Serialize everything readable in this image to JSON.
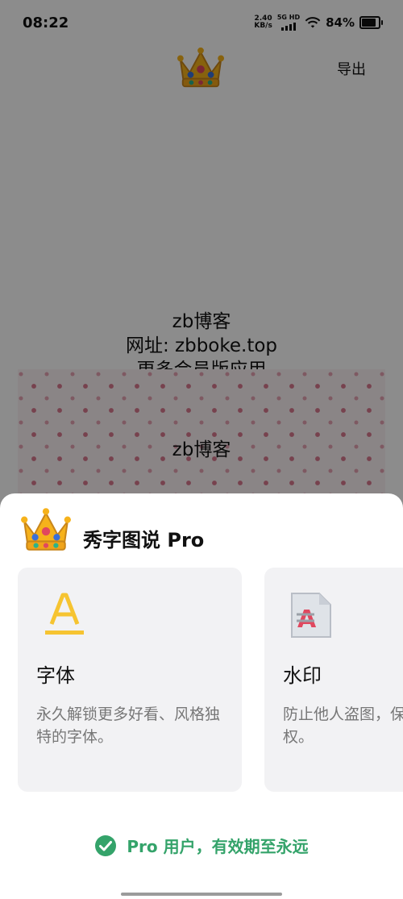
{
  "status_bar": {
    "time": "08:22",
    "net_speed_value": "2.40",
    "net_speed_unit": "KB/s",
    "net_type": "5G HD",
    "battery_percent": "84%",
    "battery_level": 0.84
  },
  "header": {
    "export_label": "导出",
    "crown_icon": "crown-icon"
  },
  "preview": {
    "line1": "zb博客",
    "line2": "网址: zbboke.top",
    "line3": "更多会员版应用",
    "dotted_text": "zb博客"
  },
  "sheet": {
    "title": "秀字图说 Pro",
    "features": [
      {
        "icon": "font-a-icon",
        "name": "字体",
        "desc": "永久解锁更多好看、风格独特的字体。"
      },
      {
        "icon": "watermark-icon",
        "name": "水印",
        "desc": "防止他人盗图，保护原创版权。"
      }
    ],
    "status_text": "Pro 用户，有效期至永远"
  },
  "colors": {
    "accent_green": "#34a36a",
    "font_icon_yellow": "#f6c431",
    "watermark_red": "#e0485f"
  }
}
